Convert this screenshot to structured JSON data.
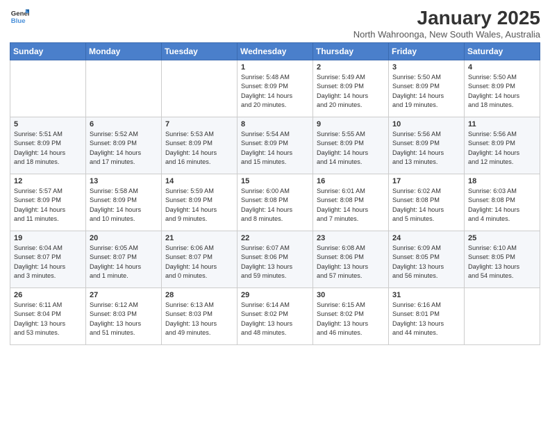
{
  "logo": {
    "line1": "General",
    "line2": "Blue"
  },
  "title": "January 2025",
  "location": "North Wahroonga, New South Wales, Australia",
  "weekdays": [
    "Sunday",
    "Monday",
    "Tuesday",
    "Wednesday",
    "Thursday",
    "Friday",
    "Saturday"
  ],
  "weeks": [
    [
      {
        "day": "",
        "info": ""
      },
      {
        "day": "",
        "info": ""
      },
      {
        "day": "",
        "info": ""
      },
      {
        "day": "1",
        "info": "Sunrise: 5:48 AM\nSunset: 8:09 PM\nDaylight: 14 hours\nand 20 minutes."
      },
      {
        "day": "2",
        "info": "Sunrise: 5:49 AM\nSunset: 8:09 PM\nDaylight: 14 hours\nand 20 minutes."
      },
      {
        "day": "3",
        "info": "Sunrise: 5:50 AM\nSunset: 8:09 PM\nDaylight: 14 hours\nand 19 minutes."
      },
      {
        "day": "4",
        "info": "Sunrise: 5:50 AM\nSunset: 8:09 PM\nDaylight: 14 hours\nand 18 minutes."
      }
    ],
    [
      {
        "day": "5",
        "info": "Sunrise: 5:51 AM\nSunset: 8:09 PM\nDaylight: 14 hours\nand 18 minutes."
      },
      {
        "day": "6",
        "info": "Sunrise: 5:52 AM\nSunset: 8:09 PM\nDaylight: 14 hours\nand 17 minutes."
      },
      {
        "day": "7",
        "info": "Sunrise: 5:53 AM\nSunset: 8:09 PM\nDaylight: 14 hours\nand 16 minutes."
      },
      {
        "day": "8",
        "info": "Sunrise: 5:54 AM\nSunset: 8:09 PM\nDaylight: 14 hours\nand 15 minutes."
      },
      {
        "day": "9",
        "info": "Sunrise: 5:55 AM\nSunset: 8:09 PM\nDaylight: 14 hours\nand 14 minutes."
      },
      {
        "day": "10",
        "info": "Sunrise: 5:56 AM\nSunset: 8:09 PM\nDaylight: 14 hours\nand 13 minutes."
      },
      {
        "day": "11",
        "info": "Sunrise: 5:56 AM\nSunset: 8:09 PM\nDaylight: 14 hours\nand 12 minutes."
      }
    ],
    [
      {
        "day": "12",
        "info": "Sunrise: 5:57 AM\nSunset: 8:09 PM\nDaylight: 14 hours\nand 11 minutes."
      },
      {
        "day": "13",
        "info": "Sunrise: 5:58 AM\nSunset: 8:09 PM\nDaylight: 14 hours\nand 10 minutes."
      },
      {
        "day": "14",
        "info": "Sunrise: 5:59 AM\nSunset: 8:09 PM\nDaylight: 14 hours\nand 9 minutes."
      },
      {
        "day": "15",
        "info": "Sunrise: 6:00 AM\nSunset: 8:08 PM\nDaylight: 14 hours\nand 8 minutes."
      },
      {
        "day": "16",
        "info": "Sunrise: 6:01 AM\nSunset: 8:08 PM\nDaylight: 14 hours\nand 7 minutes."
      },
      {
        "day": "17",
        "info": "Sunrise: 6:02 AM\nSunset: 8:08 PM\nDaylight: 14 hours\nand 5 minutes."
      },
      {
        "day": "18",
        "info": "Sunrise: 6:03 AM\nSunset: 8:08 PM\nDaylight: 14 hours\nand 4 minutes."
      }
    ],
    [
      {
        "day": "19",
        "info": "Sunrise: 6:04 AM\nSunset: 8:07 PM\nDaylight: 14 hours\nand 3 minutes."
      },
      {
        "day": "20",
        "info": "Sunrise: 6:05 AM\nSunset: 8:07 PM\nDaylight: 14 hours\nand 1 minute."
      },
      {
        "day": "21",
        "info": "Sunrise: 6:06 AM\nSunset: 8:07 PM\nDaylight: 14 hours\nand 0 minutes."
      },
      {
        "day": "22",
        "info": "Sunrise: 6:07 AM\nSunset: 8:06 PM\nDaylight: 13 hours\nand 59 minutes."
      },
      {
        "day": "23",
        "info": "Sunrise: 6:08 AM\nSunset: 8:06 PM\nDaylight: 13 hours\nand 57 minutes."
      },
      {
        "day": "24",
        "info": "Sunrise: 6:09 AM\nSunset: 8:05 PM\nDaylight: 13 hours\nand 56 minutes."
      },
      {
        "day": "25",
        "info": "Sunrise: 6:10 AM\nSunset: 8:05 PM\nDaylight: 13 hours\nand 54 minutes."
      }
    ],
    [
      {
        "day": "26",
        "info": "Sunrise: 6:11 AM\nSunset: 8:04 PM\nDaylight: 13 hours\nand 53 minutes."
      },
      {
        "day": "27",
        "info": "Sunrise: 6:12 AM\nSunset: 8:03 PM\nDaylight: 13 hours\nand 51 minutes."
      },
      {
        "day": "28",
        "info": "Sunrise: 6:13 AM\nSunset: 8:03 PM\nDaylight: 13 hours\nand 49 minutes."
      },
      {
        "day": "29",
        "info": "Sunrise: 6:14 AM\nSunset: 8:02 PM\nDaylight: 13 hours\nand 48 minutes."
      },
      {
        "day": "30",
        "info": "Sunrise: 6:15 AM\nSunset: 8:02 PM\nDaylight: 13 hours\nand 46 minutes."
      },
      {
        "day": "31",
        "info": "Sunrise: 6:16 AM\nSunset: 8:01 PM\nDaylight: 13 hours\nand 44 minutes."
      },
      {
        "day": "",
        "info": ""
      }
    ]
  ]
}
